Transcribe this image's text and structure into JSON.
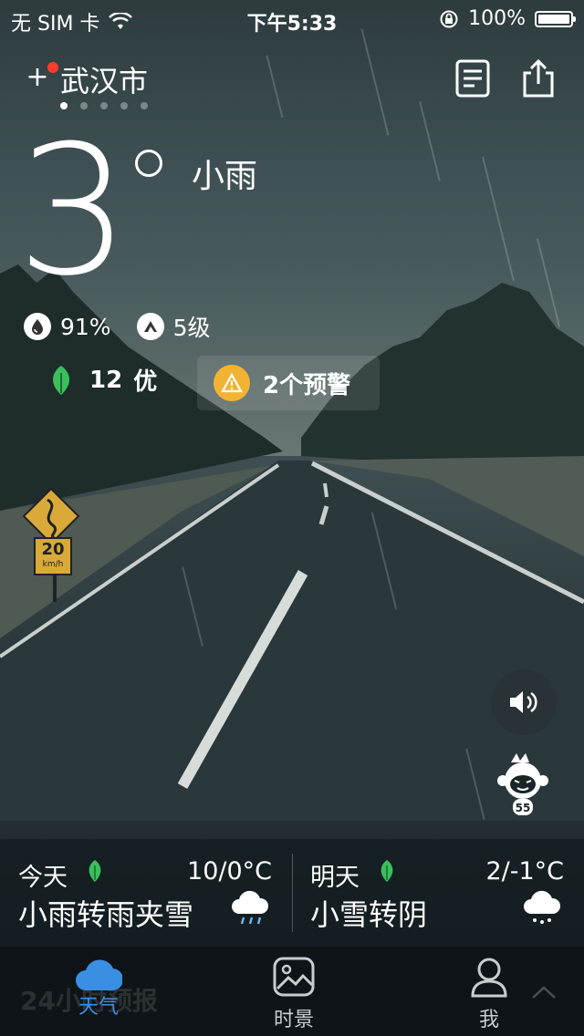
{
  "status_bar": {
    "carrier": "无 SIM 卡",
    "time": "下午5:33",
    "battery": "100%"
  },
  "header": {
    "city": "武汉市",
    "page_count": 5,
    "active_page": 0
  },
  "current": {
    "temperature": "3",
    "condition": "小雨",
    "humidity": "91%",
    "wind": "5级",
    "aqi_value": "12",
    "aqi_level": "优",
    "warning": "2个预警"
  },
  "road_sign": {
    "speed": "20",
    "unit": "km/h"
  },
  "forecast": [
    {
      "day": "今天",
      "range": "10/0°C",
      "desc": "小雨转雨夹雪"
    },
    {
      "day": "明天",
      "range": "2/-1°C",
      "desc": "小雪转阴"
    }
  ],
  "tabbar": {
    "hint": "24小时预报",
    "tabs": [
      {
        "label": "天气"
      },
      {
        "label": "时景"
      },
      {
        "label": "我"
      }
    ]
  },
  "colors": {
    "accent_blue": "#3b8fe3",
    "leaf_green": "#3bbf5c",
    "warning_yellow": "#f2b335",
    "red_dot": "#ff3b30"
  }
}
